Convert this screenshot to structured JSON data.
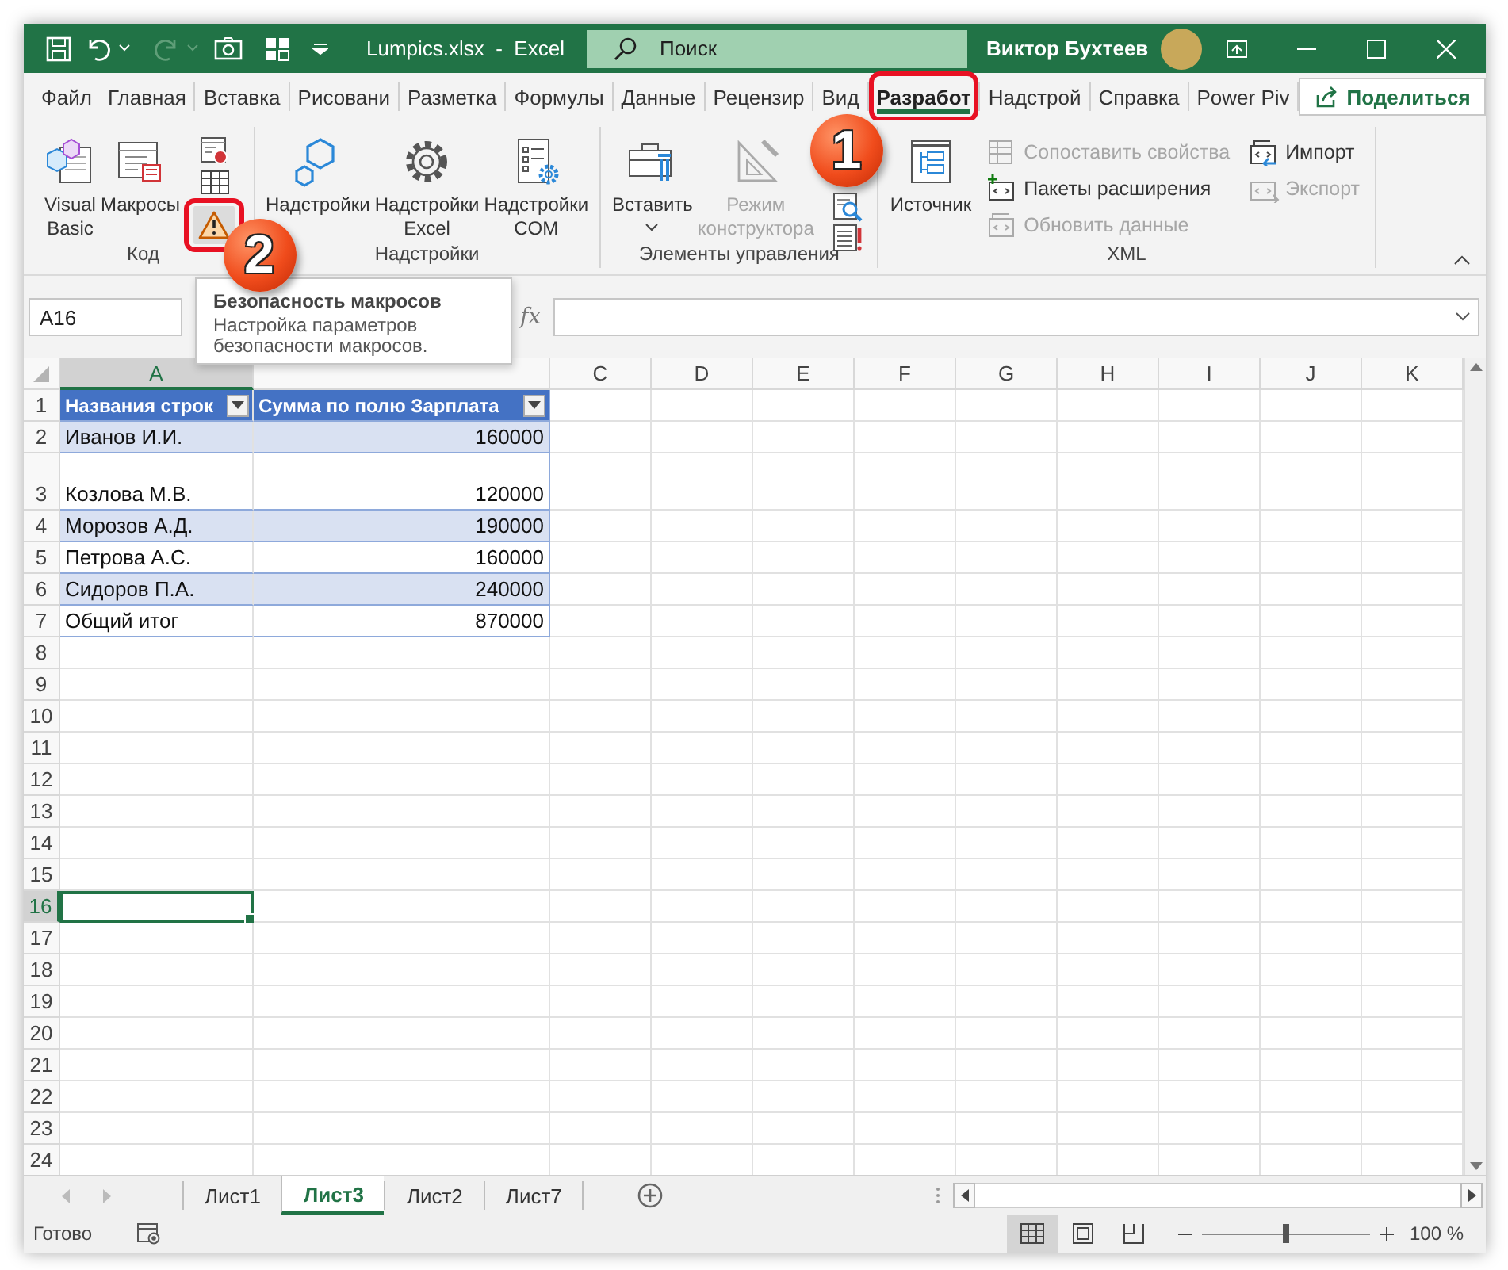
{
  "title_bar": {
    "file_name": "Lumpics.xlsx  -  Excel",
    "search": {
      "placeholder": "Поиск"
    },
    "user_name": "Виктор Бухтеев"
  },
  "ribbon_tabs": [
    {
      "label": "Файл",
      "selected": false,
      "highlighted": false
    },
    {
      "label": "Главная",
      "selected": false,
      "highlighted": false
    },
    {
      "label": "Вставка",
      "selected": false,
      "highlighted": false
    },
    {
      "label": "Рисовани",
      "selected": false,
      "highlighted": false
    },
    {
      "label": "Разметка",
      "selected": false,
      "highlighted": false
    },
    {
      "label": "Формулы",
      "selected": false,
      "highlighted": false
    },
    {
      "label": "Данные",
      "selected": false,
      "highlighted": false
    },
    {
      "label": "Рецензир",
      "selected": false,
      "highlighted": false
    },
    {
      "label": "Вид",
      "selected": false,
      "highlighted": false
    },
    {
      "label": "Разработ",
      "selected": true,
      "highlighted": true
    },
    {
      "label": "Надстрой",
      "selected": false,
      "highlighted": false
    },
    {
      "label": "Справка",
      "selected": false,
      "highlighted": false
    },
    {
      "label": "Power Piv",
      "selected": false,
      "highlighted": false
    }
  ],
  "share_button": {
    "label": "Поделиться"
  },
  "ribbon_groups": [
    {
      "label": "Код",
      "commands": [
        {
          "kind": "large",
          "label": "Visual Basic",
          "disabled": false,
          "dropdown": false
        },
        {
          "kind": "large",
          "label": "Макросы",
          "disabled": false,
          "dropdown": false
        },
        {
          "kind": "icons",
          "items": [
            {
              "disabled": false,
              "hovered": false,
              "highlighted": false
            },
            {
              "disabled": false,
              "hovered": false,
              "highlighted": false
            },
            {
              "disabled": false,
              "hovered": true,
              "highlighted": true
            }
          ]
        }
      ]
    },
    {
      "label": "Надстройки",
      "commands": [
        {
          "kind": "large",
          "label": "Надстройки",
          "disabled": false,
          "dropdown": false
        },
        {
          "kind": "large",
          "label": "Надстройки Excel",
          "disabled": false,
          "dropdown": false
        },
        {
          "kind": "large",
          "label": "Надстройки COM",
          "disabled": false,
          "dropdown": false
        }
      ]
    },
    {
      "label": "Элементы управления",
      "commands": [
        {
          "kind": "large",
          "label": "Вставить",
          "disabled": false,
          "dropdown": true
        },
        {
          "kind": "large",
          "label": "Режим конструктора",
          "disabled": true,
          "dropdown": false
        },
        {
          "kind": "icons",
          "items": [
            {
              "disabled": false,
              "hovered": false,
              "highlighted": false
            },
            {
              "disabled": false,
              "hovered": false,
              "highlighted": false
            }
          ]
        }
      ]
    },
    {
      "label": "XML",
      "commands": [
        {
          "kind": "large",
          "label": "Источник",
          "disabled": false,
          "dropdown": false
        },
        {
          "kind": "list",
          "items": [
            {
              "label": "Сопоставить свойства",
              "disabled": true
            },
            {
              "label": "Пакеты расширения",
              "disabled": false
            },
            {
              "label": "Обновить данные",
              "disabled": true
            }
          ]
        },
        {
          "kind": "list",
          "items": [
            {
              "label": "Импорт",
              "disabled": false
            },
            {
              "label": "Экспорт",
              "disabled": true
            }
          ]
        }
      ]
    }
  ],
  "formula_bar": {
    "name_box": "A16",
    "function_label": "fx"
  },
  "columns": [
    {
      "letter": "A",
      "selected": true
    },
    {
      "selected": false
    },
    {
      "letter": "C",
      "selected": false
    },
    {
      "letter": "D",
      "selected": false
    },
    {
      "letter": "E",
      "selected": false
    },
    {
      "letter": "F",
      "selected": false
    },
    {
      "letter": "G",
      "selected": false
    },
    {
      "letter": "H",
      "selected": false
    },
    {
      "letter": "I",
      "selected": false
    },
    {
      "letter": "J",
      "selected": false
    },
    {
      "letter": "K",
      "selected": false
    }
  ],
  "rows": [
    {
      "number": "1",
      "kind": "header",
      "cells": [
        "Названия строк",
        "Сумма по полю Зарплата"
      ],
      "tall": false,
      "selected": false
    },
    {
      "number": "2",
      "kind": "data",
      "cells": [
        "Иванов И.И.",
        "160000"
      ],
      "banded": true,
      "tall": false,
      "selected": false
    },
    {
      "number": "3",
      "kind": "data",
      "cells": [
        "Козлова М.В.",
        "120000"
      ],
      "banded": false,
      "tall": true,
      "selected": false
    },
    {
      "number": "4",
      "kind": "data",
      "cells": [
        "Морозов А.Д.",
        "190000"
      ],
      "banded": true,
      "tall": false,
      "selected": false
    },
    {
      "number": "5",
      "kind": "data",
      "cells": [
        "Петрова А.С.",
        "160000"
      ],
      "banded": false,
      "tall": false,
      "selected": false
    },
    {
      "number": "6",
      "kind": "data",
      "cells": [
        "Сидоров П.А.",
        "240000"
      ],
      "banded": true,
      "tall": false,
      "selected": false
    },
    {
      "number": "7",
      "kind": "total",
      "cells": [
        "Общий итог",
        "870000"
      ],
      "banded": false,
      "tall": false,
      "selected": false
    },
    {
      "number": "8",
      "kind": "empty",
      "selected": false
    },
    {
      "number": "9",
      "kind": "empty",
      "selected": false
    },
    {
      "number": "10",
      "kind": "empty",
      "selected": false
    },
    {
      "number": "11",
      "kind": "empty",
      "selected": false
    },
    {
      "number": "12",
      "kind": "empty",
      "selected": false
    },
    {
      "number": "13",
      "kind": "empty",
      "selected": false
    },
    {
      "number": "14",
      "kind": "empty",
      "selected": false
    },
    {
      "number": "15",
      "kind": "empty",
      "selected": false
    },
    {
      "number": "16",
      "kind": "empty",
      "selected": true
    },
    {
      "number": "17",
      "kind": "empty",
      "selected": false
    },
    {
      "number": "18",
      "kind": "empty",
      "selected": false
    },
    {
      "number": "19",
      "kind": "empty",
      "selected": false
    },
    {
      "number": "20",
      "kind": "empty",
      "selected": false
    },
    {
      "number": "21",
      "kind": "empty",
      "selected": false
    },
    {
      "number": "22",
      "kind": "empty",
      "selected": false
    },
    {
      "number": "23",
      "kind": "empty",
      "selected": false
    },
    {
      "number": "24",
      "kind": "empty",
      "selected": false
    }
  ],
  "tooltip": {
    "title": "Безопасность макросов",
    "text": "Настройка параметров безопасности макросов."
  },
  "sheet_tabs": [
    {
      "label": "Лист1",
      "selected": false
    },
    {
      "label": "Лист3",
      "selected": true
    },
    {
      "label": "Лист2",
      "selected": false
    },
    {
      "label": "Лист7",
      "selected": false
    }
  ],
  "status_bar": {
    "status": "Готово",
    "views": [
      {
        "selected": true
      },
      {
        "selected": false
      },
      {
        "selected": false
      }
    ],
    "zoom_slider": {
      "level": 0.5
    },
    "zoom": "100 %"
  },
  "annotations": [
    {
      "number": "1"
    },
    {
      "number": "2"
    }
  ]
}
